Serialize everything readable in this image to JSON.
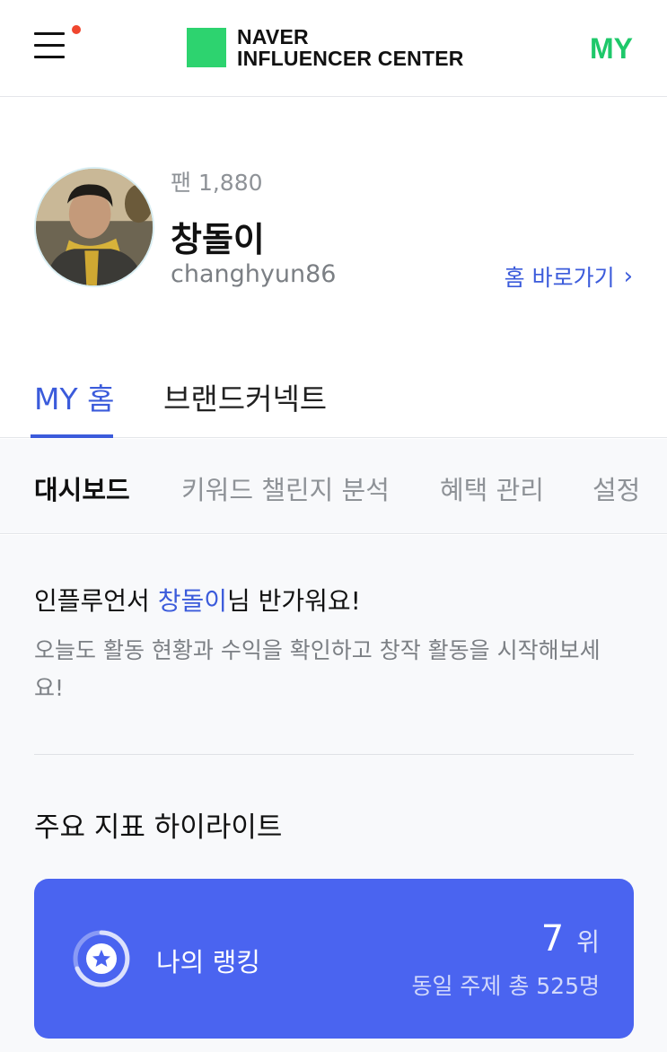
{
  "header": {
    "logo_line1": "NAVER",
    "logo_line2": "INFLUENCER CENTER",
    "my_label": "MY",
    "brand_color": "#2dd36f",
    "accent_color": "#1ec86a",
    "notification_dot_color": "#f0462e",
    "icons": {
      "menu": "hamburger-menu-icon",
      "logo": "naver-logo-icon"
    }
  },
  "profile": {
    "fan_count": "팬 1,880",
    "name": "창돌이",
    "id": "changhyun86",
    "home_link_label": "홈 바로가기",
    "home_link_chevron": "›"
  },
  "main_tabs": [
    {
      "label": "MY 홈",
      "active": true
    },
    {
      "label": "브랜드커넥트",
      "active": false
    }
  ],
  "sub_tabs": [
    {
      "label": "대시보드",
      "active": true
    },
    {
      "label": "키워드 챌린지 분석",
      "active": false
    },
    {
      "label": "혜택 관리",
      "active": false
    },
    {
      "label": "설정",
      "active": false
    }
  ],
  "welcome": {
    "prefix": "인플루언서 ",
    "name": "창돌이",
    "suffix": "님 반가워요!",
    "description": "오늘도 활동 현황과 수익을 확인하고 창작 활동을 시작해보세요!"
  },
  "highlights": {
    "title": "주요 지표 하이라이트",
    "ranking": {
      "label": "나의 랭킹",
      "value": "7",
      "unit": "위",
      "subtext": "동일 주제 총 525명",
      "card_color": "#4a64f0",
      "icon": "star-ranking-icon"
    }
  },
  "colors": {
    "link_blue": "#3b5bdb"
  }
}
